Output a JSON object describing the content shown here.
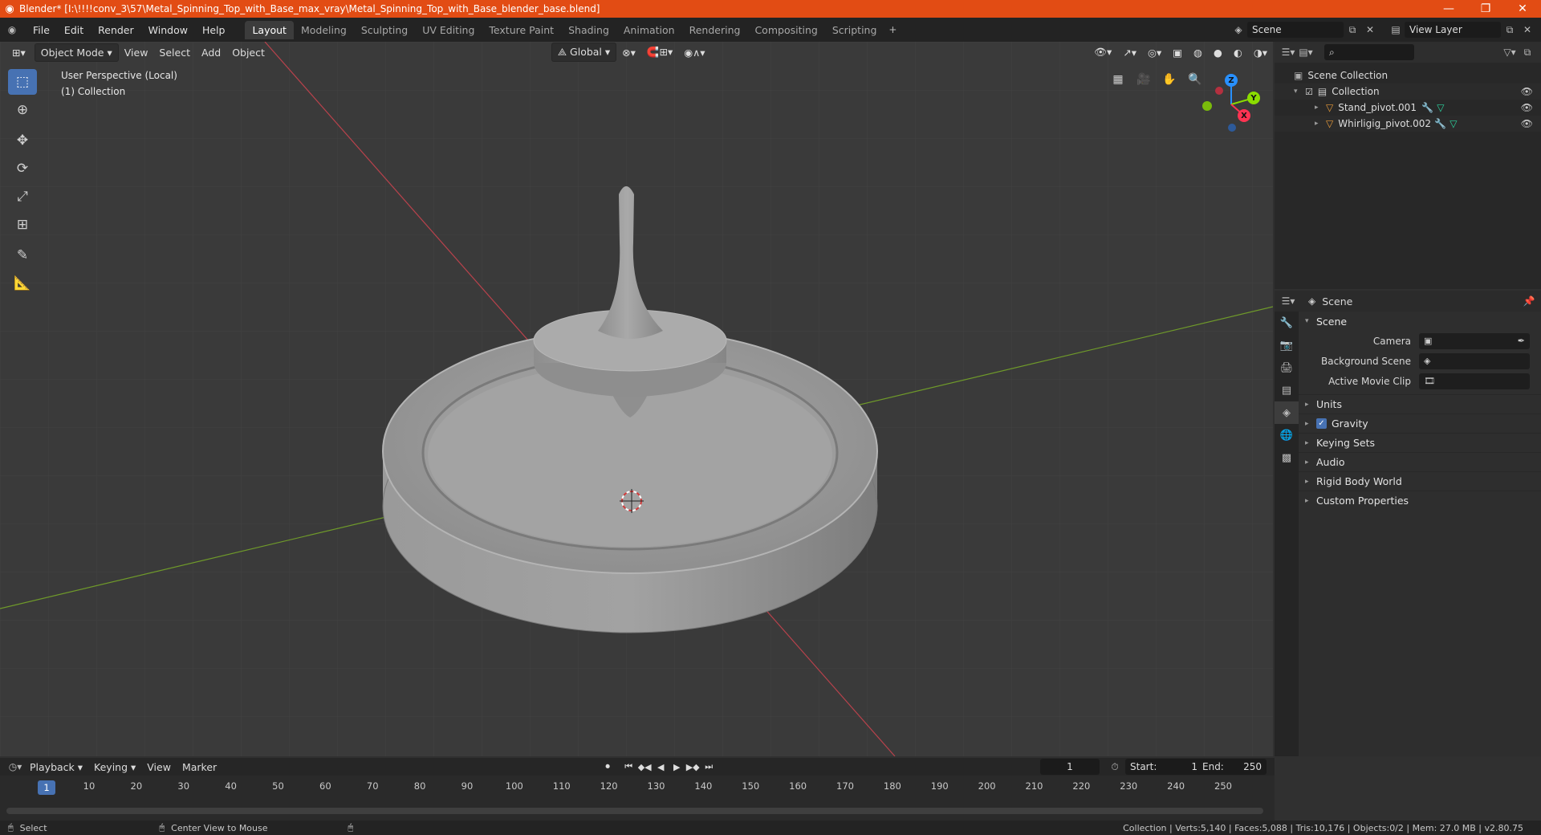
{
  "window": {
    "title": "Blender* [I:\\!!!!conv_3\\57\\Metal_Spinning_Top_with_Base_max_vray\\Metal_Spinning_Top_with_Base_blender_base.blend]",
    "minimize": "—",
    "maximize": "❐",
    "close": "✕"
  },
  "menus": [
    "File",
    "Edit",
    "Render",
    "Window",
    "Help"
  ],
  "workspaces": [
    "Layout",
    "Modeling",
    "Sculpting",
    "UV Editing",
    "Texture Paint",
    "Shading",
    "Animation",
    "Rendering",
    "Compositing",
    "Scripting"
  ],
  "active_workspace": "Layout",
  "scene_field": "Scene",
  "view_layer_field": "View Layer",
  "viewport": {
    "mode": "Object Mode",
    "menus": [
      "View",
      "Select",
      "Add",
      "Object"
    ],
    "transform_orientation": "Global",
    "info_line1": "User Perspective (Local)",
    "info_line2": "(1) Collection",
    "gizmo_axes": {
      "x": "X",
      "y": "Y",
      "z": "Z"
    }
  },
  "outliner": {
    "root": "Scene Collection",
    "collection": "Collection",
    "objects": [
      "Stand_pivot.001",
      "Whirligig_pivot.002"
    ]
  },
  "properties": {
    "context": "Scene",
    "panel": "Scene",
    "fields": [
      {
        "label": "Camera",
        "value": ""
      },
      {
        "label": "Background Scene",
        "value": ""
      },
      {
        "label": "Active Movie Clip",
        "value": ""
      }
    ],
    "subpanels": [
      "Units",
      "Gravity",
      "Keying Sets",
      "Audio",
      "Rigid Body World",
      "Custom Properties"
    ],
    "gravity_checked": true
  },
  "timeline": {
    "menus": [
      "Playback",
      "Keying",
      "View",
      "Marker"
    ],
    "current_frame": "1",
    "start_label": "Start:",
    "start": "1",
    "end_label": "End:",
    "end": "250",
    "ticks": [
      "1",
      "10",
      "20",
      "30",
      "40",
      "50",
      "60",
      "70",
      "80",
      "90",
      "100",
      "110",
      "120",
      "130",
      "140",
      "150",
      "160",
      "170",
      "180",
      "190",
      "200",
      "210",
      "220",
      "230",
      "240",
      "250"
    ]
  },
  "statusbar": {
    "left_action": "Select",
    "mid_action": "Center View to Mouse",
    "stats": "Collection | Verts:5,140 | Faces:5,088 | Tris:10,176 | Objects:0/2 | Mem: 27.0 MB | v2.80.75"
  },
  "colors": {
    "titlebar": "#e24c14",
    "accent": "#4772b3",
    "axis_x": "#ff3352",
    "axis_y": "#8bdc00",
    "axis_z": "#2890ff",
    "object_icon": "#e89b3a"
  }
}
